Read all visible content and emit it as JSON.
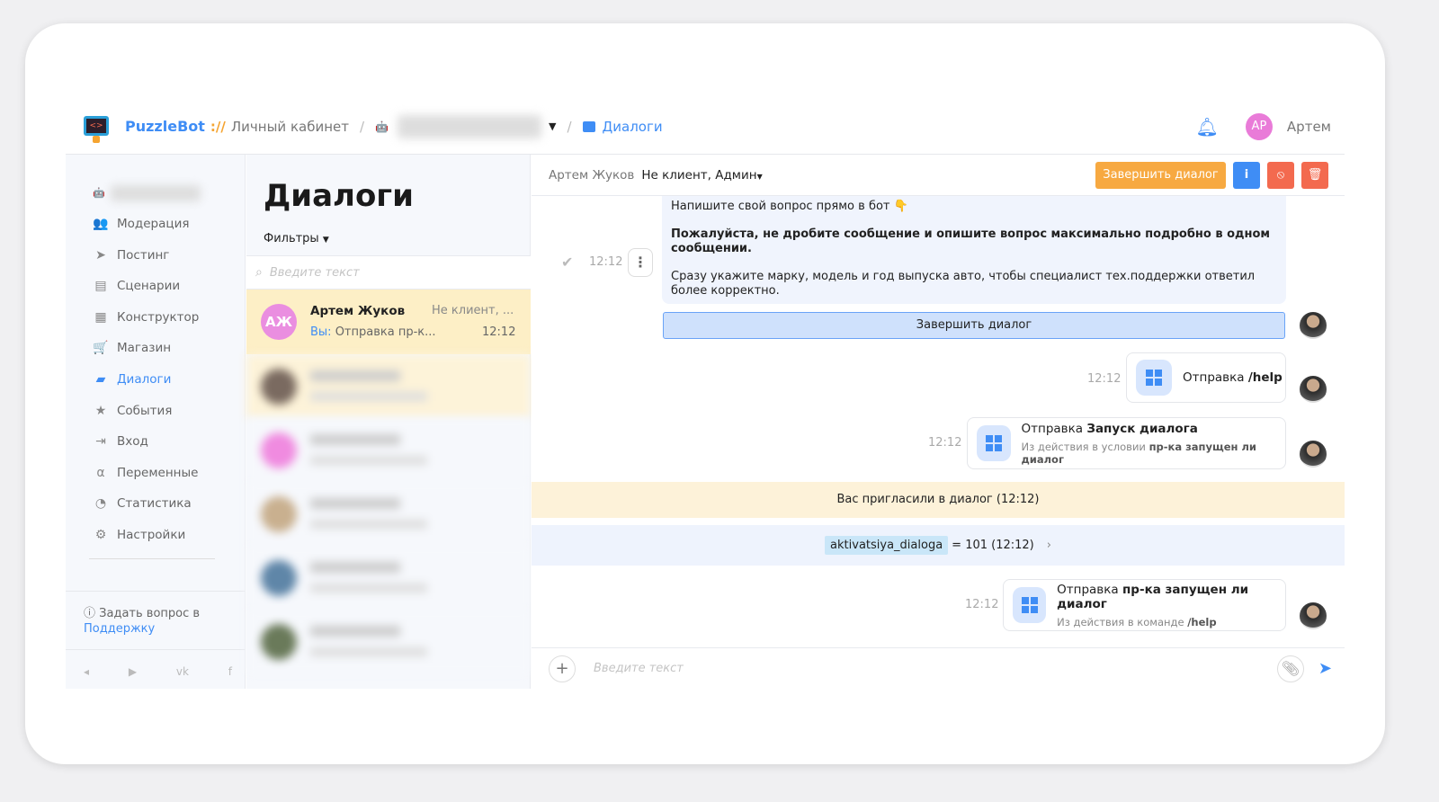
{
  "header": {
    "brand": "PuzzleBot",
    "separator": "://",
    "cabinet": "Личный кабинет",
    "section": "Диалоги",
    "user_initials": "АР",
    "user_name": "Артем"
  },
  "sidebar": {
    "items": [
      {
        "label": "Модерация",
        "icon": "users-icon",
        "glyph": "👥"
      },
      {
        "label": "Постинг",
        "icon": "paper-plane-icon",
        "glyph": "➤"
      },
      {
        "label": "Сценарии",
        "icon": "scenarios-icon",
        "glyph": "▤"
      },
      {
        "label": "Конструктор",
        "icon": "grid-icon",
        "glyph": "▦"
      },
      {
        "label": "Магазин",
        "icon": "cart-icon",
        "glyph": "🛒"
      },
      {
        "label": "Диалоги",
        "icon": "chat-icon",
        "glyph": "▰"
      },
      {
        "label": "События",
        "icon": "star-icon",
        "glyph": "★"
      },
      {
        "label": "Вход",
        "icon": "login-icon",
        "glyph": "⇥"
      },
      {
        "label": "Переменные",
        "icon": "variable-icon",
        "glyph": "α"
      },
      {
        "label": "Статистика",
        "icon": "pie-chart-icon",
        "glyph": "◔"
      },
      {
        "label": "Настройки",
        "icon": "gear-icon",
        "glyph": "⚙"
      }
    ],
    "help_text": "Задать вопрос в",
    "help_link": "Поддержку",
    "socials": [
      "◂",
      "▶",
      "vk",
      "f"
    ]
  },
  "list": {
    "title": "Диалоги",
    "filters": "Фильтры",
    "search_placeholder": "Введите текст",
    "active": {
      "initials": "АЖ",
      "name": "Артем Жуков",
      "status": "Не клиент, ...",
      "you": "Вы:",
      "preview": "Отправка пр-к...",
      "time": "12:12"
    }
  },
  "chat": {
    "contact": "Артем Жуков",
    "status": "Не клиент, Админ",
    "finish": "Завершить диалог",
    "msg1": {
      "time": "12:12",
      "l1": "Напишите свой вопрос прямо в бот 👇",
      "l2": "Пожалуйста, не дробите сообщение и опишите вопрос максимально подробно в одном сообщении.",
      "l3": "Сразу укажите марку, модель и год выпуска авто, чтобы специалист тех.поддержки ответил более корректно.",
      "button": "Завершить диалог"
    },
    "msg2": {
      "time": "12:12",
      "pre": "Отправка",
      "bold": "/help"
    },
    "msg3": {
      "time": "12:12",
      "pre": "Отправка",
      "bold": "Запуск диалога",
      "sub_pre": "Из действия в условии",
      "sub_bold": "пр-ка запущен ли диалог"
    },
    "invite": "Вас пригласили в диалог (12:12)",
    "variable": {
      "name": "aktivatsiya_dialoga",
      "value": "= 101 (12:12)"
    },
    "msg4": {
      "time": "12:12",
      "pre": "Отправка",
      "bold": "пр-ка запущен ли диалог",
      "sub_pre": "Из действия в команде",
      "sub_bold": "/help"
    },
    "input_placeholder": "Введите текст"
  },
  "colors": {
    "accent": "#3f8df5",
    "orange": "#f7a941",
    "red": "#f36a4f"
  }
}
